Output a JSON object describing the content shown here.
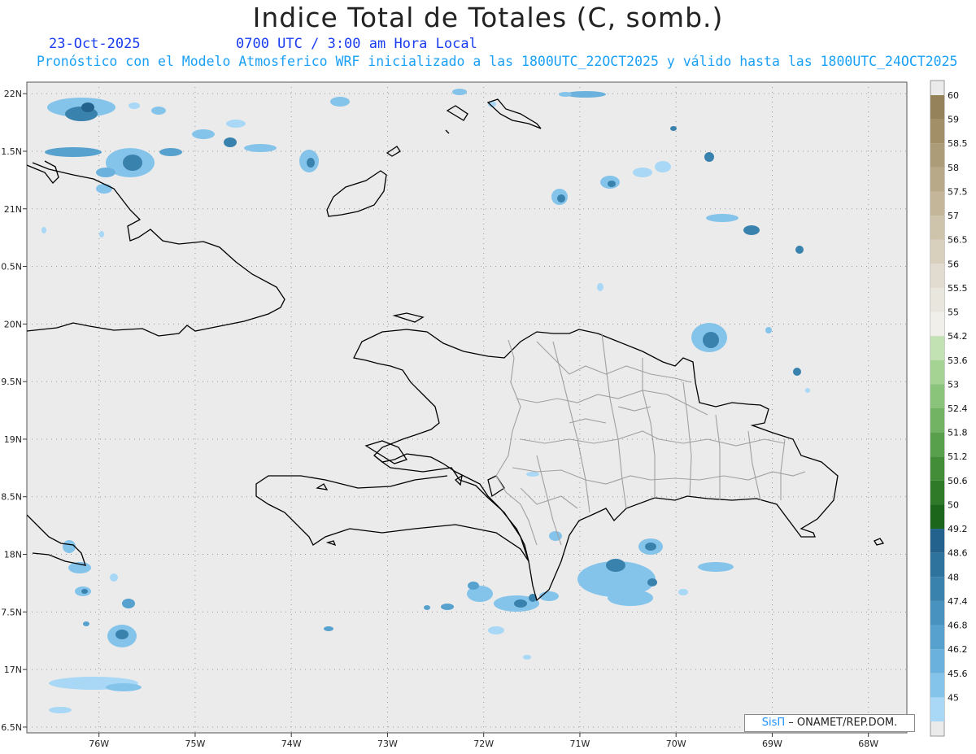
{
  "title": "Indice Total de Totales (C, somb.)",
  "date": "23-Oct-2025",
  "time": "0700 UTC / 3:00 am Hora Local",
  "description": "Pronóstico con el Modelo Atmosferico WRF inicializado a las 1800UTC_22OCT2025 y válido hasta las  1800UTC_24OCT2025",
  "credit": {
    "logo": "SisΠ",
    "text": " – ONAMET/REP.DOM."
  },
  "map": {
    "lon_min": -76.75,
    "lon_max": -67.6,
    "lat_min": 16.45,
    "lat_max": 22.1,
    "lat_ticks": [
      {
        "v": 22.0,
        "label": "22N"
      },
      {
        "v": 21.5,
        "label": "1.5N"
      },
      {
        "v": 21.0,
        "label": "21N"
      },
      {
        "v": 20.5,
        "label": "0.5N"
      },
      {
        "v": 20.0,
        "label": "20N"
      },
      {
        "v": 19.5,
        "label": "9.5N"
      },
      {
        "v": 19.0,
        "label": "19N"
      },
      {
        "v": 18.5,
        "label": "8.5N"
      },
      {
        "v": 18.0,
        "label": "18N"
      },
      {
        "v": 17.5,
        "label": "7.5N"
      },
      {
        "v": 17.0,
        "label": "17N"
      },
      {
        "v": 16.5,
        "label": "6.5N"
      }
    ],
    "lon_ticks": [
      {
        "v": -76,
        "label": "76W"
      },
      {
        "v": -75,
        "label": "75W"
      },
      {
        "v": -74,
        "label": "74W"
      },
      {
        "v": -73,
        "label": "73W"
      },
      {
        "v": -72,
        "label": "72W"
      },
      {
        "v": -71,
        "label": "71W"
      },
      {
        "v": -70,
        "label": "70W"
      },
      {
        "v": -69,
        "label": "69W"
      },
      {
        "v": -68,
        "label": "68W"
      }
    ],
    "colors": {
      "ocean": "#ebebeb",
      "coast": "#000000",
      "provinces": "#a0a0a0",
      "grid": "#999999"
    }
  },
  "colorbar": {
    "levels": [
      {
        "label": "60",
        "color": "#96825a"
      },
      {
        "label": "59",
        "color": "#a28f68"
      },
      {
        "label": "58.5",
        "color": "#ad9c78"
      },
      {
        "label": "58",
        "color": "#b8a988"
      },
      {
        "label": "57.5",
        "color": "#c3b699"
      },
      {
        "label": "57",
        "color": "#cec4ab"
      },
      {
        "label": "56.5",
        "color": "#d8d0bd"
      },
      {
        "label": "56",
        "color": "#e1dccf"
      },
      {
        "label": "55.5",
        "color": "#e9e6de"
      },
      {
        "label": "55",
        "color": "#f0efea"
      },
      {
        "label": "54.2",
        "color": "#c2e2b4"
      },
      {
        "label": "53.6",
        "color": "#a5d394"
      },
      {
        "label": "53",
        "color": "#8ac37a"
      },
      {
        "label": "52.4",
        "color": "#71b362"
      },
      {
        "label": "51.8",
        "color": "#59a04c"
      },
      {
        "label": "51.2",
        "color": "#438d39"
      },
      {
        "label": "50.6",
        "color": "#2f7a29"
      },
      {
        "label": "50",
        "color": "#1b661a"
      },
      {
        "label": "49.2",
        "color": "#23628c"
      },
      {
        "label": "48.6",
        "color": "#2e729e"
      },
      {
        "label": "48",
        "color": "#3a82ae"
      },
      {
        "label": "47.4",
        "color": "#4892bf"
      },
      {
        "label": "46.8",
        "color": "#56a1ce"
      },
      {
        "label": "46.2",
        "color": "#6ab1dd"
      },
      {
        "label": "45.6",
        "color": "#84c3ea"
      },
      {
        "label": "45",
        "color": "#a8d8f5"
      }
    ]
  }
}
